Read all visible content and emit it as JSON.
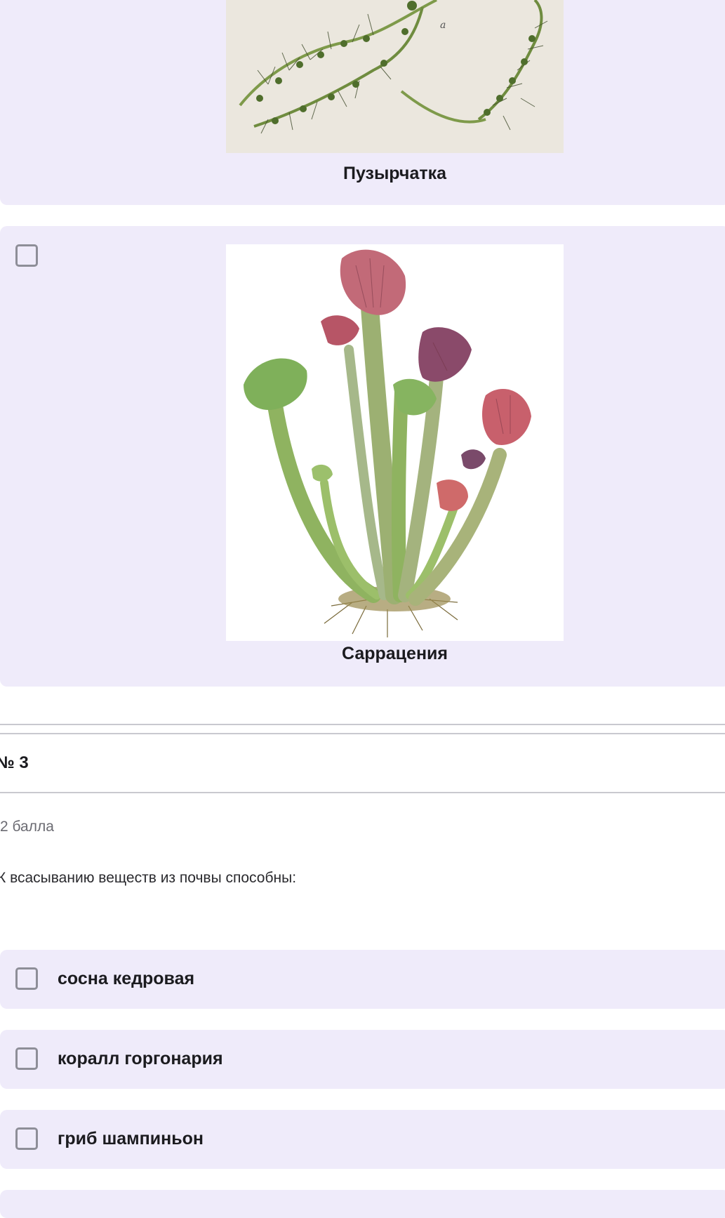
{
  "answers": [
    {
      "caption": "Пузырчатка",
      "image": "bladderwort-illustration"
    },
    {
      "caption": "Саррацения",
      "image": "sarracenia-illustration"
    }
  ],
  "question": {
    "number": "№ 3",
    "points": "2 балла",
    "text": "К всасыванию веществ из почвы способны:",
    "options": [
      {
        "label": "сосна кедровая",
        "checked": false
      },
      {
        "label": "коралл горгонария",
        "checked": false
      },
      {
        "label": "гриб шампиньон",
        "checked": false
      }
    ]
  },
  "colors": {
    "card_bg": "#efebfa",
    "checkbox_border": "#8e8e98",
    "divider": "#c9c9cf"
  }
}
